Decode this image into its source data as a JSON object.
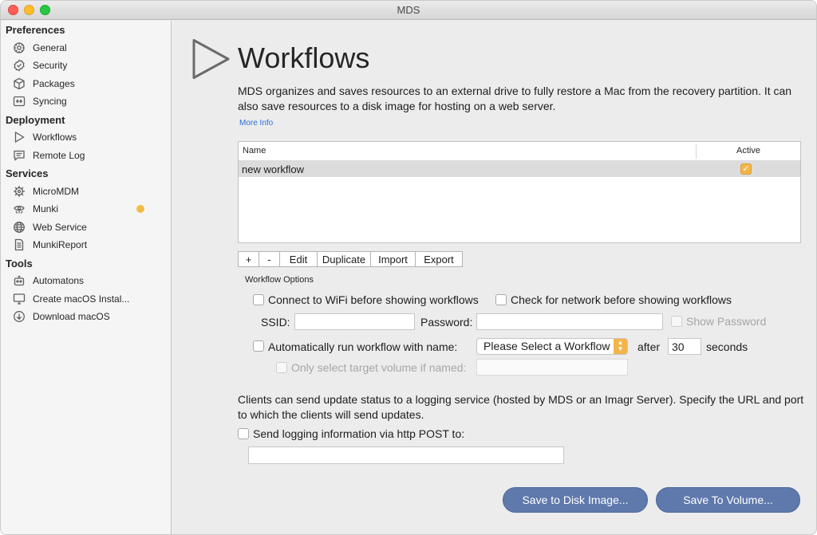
{
  "window": {
    "title": "MDS"
  },
  "sidebar": {
    "sections": [
      {
        "label": "Preferences",
        "items": [
          {
            "label": "General",
            "icon": "gear-icon"
          },
          {
            "label": "Security",
            "icon": "shield-check-icon"
          },
          {
            "label": "Packages",
            "icon": "package-icon"
          },
          {
            "label": "Syncing",
            "icon": "sync-icon"
          }
        ]
      },
      {
        "label": "Deployment",
        "items": [
          {
            "label": "Workflows",
            "icon": "play-icon"
          },
          {
            "label": "Remote Log",
            "icon": "speech-bubble-icon"
          }
        ]
      },
      {
        "label": "Services",
        "items": [
          {
            "label": "MicroMDM",
            "icon": "helm-icon"
          },
          {
            "label": "Munki",
            "icon": "munki-icon",
            "status_color": "#f3bc46"
          },
          {
            "label": "Web Service",
            "icon": "globe-icon"
          },
          {
            "label": "MunkiReport",
            "icon": "document-icon"
          }
        ]
      },
      {
        "label": "Tools",
        "items": [
          {
            "label": "Automatons",
            "icon": "robot-icon"
          },
          {
            "label": "Create macOS Instal...",
            "icon": "monitor-icon"
          },
          {
            "label": "Download macOS",
            "icon": "download-icon"
          }
        ]
      }
    ]
  },
  "main": {
    "title": "Workflows",
    "description": "MDS organizes and saves resources to an external drive to fully restore a Mac from the recovery partition. It can also save resources to a disk image for hosting on a web server.",
    "more_info": "More Info",
    "table": {
      "columns": [
        "Name",
        "Active"
      ],
      "rows": [
        {
          "name": "new workflow",
          "active": true
        }
      ]
    },
    "table_buttons": [
      "+",
      "-",
      "Edit",
      "Duplicate",
      "Import",
      "Export"
    ],
    "options": {
      "group_label": "Workflow Options",
      "wifi_label": "Connect to WiFi before showing workflows",
      "network_label": "Check for network before showing workflows",
      "ssid_label": "SSID:",
      "password_label": "Password:",
      "show_password_label": "Show Password",
      "auto_run_label": "Automatically run workflow with name:",
      "workflow_select": "Please Select a Workflow",
      "after_label": "after",
      "seconds_value": "30",
      "seconds_label": "seconds",
      "target_volume_label": "Only select target volume if named:"
    },
    "logging": {
      "description": "Clients can send update status to a logging service (hosted by MDS or an Imagr Server). Specify the URL and port to which the clients will send updates.",
      "checkbox_label": "Send logging information via http POST to:"
    },
    "buttons": {
      "save_disk_image": "Save to Disk Image...",
      "save_volume": "Save To Volume..."
    },
    "accent_color": "#f3b54a",
    "button_color": "#5f79ad"
  }
}
